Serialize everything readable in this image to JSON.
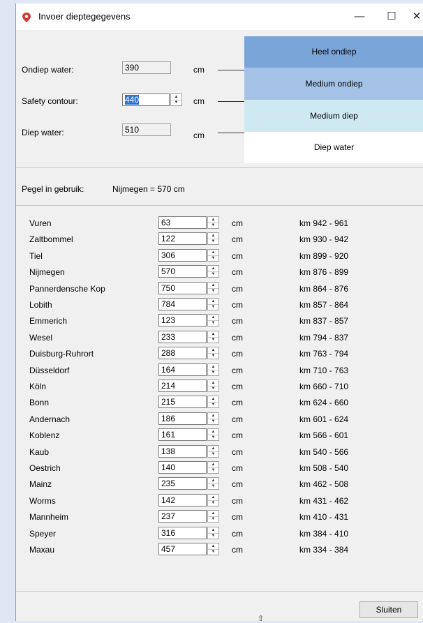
{
  "window": {
    "title": "Invoer dieptegegevens"
  },
  "depth": {
    "shallow": {
      "label": "Ondiep water:",
      "value": "390",
      "unit": "cm"
    },
    "safety": {
      "label": "Safety contour:",
      "value": "440",
      "unit": "cm"
    },
    "deep": {
      "label": "Diep water:",
      "value": "510",
      "unit": "cm"
    }
  },
  "legend": [
    {
      "label": "Heel ondiep",
      "color": "#7aa5d8"
    },
    {
      "label": "Medium ondiep",
      "color": "#a4c3e7"
    },
    {
      "label": "Medium diep",
      "color": "#cfe9f2"
    },
    {
      "label": "Diep water",
      "color": "#ffffff"
    }
  ],
  "gauge": {
    "label": "Pegel in gebruik:",
    "value": "Nijmegen = 570 cm"
  },
  "unit": "cm",
  "stations": [
    {
      "name": "Vuren",
      "value": "63",
      "range": "km 942 - 961"
    },
    {
      "name": "Zaltbommel",
      "value": "122",
      "range": "km 930 - 942"
    },
    {
      "name": "Tiel",
      "value": "306",
      "range": "km 899 - 920"
    },
    {
      "name": "Nijmegen",
      "value": "570",
      "range": "km 876 - 899"
    },
    {
      "name": "Pannerdensche Kop",
      "value": "750",
      "range": "km 864 - 876"
    },
    {
      "name": "Lobith",
      "value": "784",
      "range": "km 857 - 864"
    },
    {
      "name": "Emmerich",
      "value": "123",
      "range": "km 837 - 857"
    },
    {
      "name": "Wesel",
      "value": "233",
      "range": "km 794 - 837"
    },
    {
      "name": "Duisburg-Ruhrort",
      "value": "288",
      "range": "km 763 - 794"
    },
    {
      "name": "Düsseldorf",
      "value": "164",
      "range": "km 710 - 763"
    },
    {
      "name": "Köln",
      "value": "214",
      "range": "km 660 - 710"
    },
    {
      "name": "Bonn",
      "value": "215",
      "range": "km 624 - 660"
    },
    {
      "name": "Andernach",
      "value": "186",
      "range": "km 601 - 624"
    },
    {
      "name": "Koblenz",
      "value": "161",
      "range": "km 566 - 601"
    },
    {
      "name": "Kaub",
      "value": "138",
      "range": "km 540 - 566"
    },
    {
      "name": "Oestrich",
      "value": "140",
      "range": "km 508 - 540"
    },
    {
      "name": "Mainz",
      "value": "235",
      "range": "km 462 - 508"
    },
    {
      "name": "Worms",
      "value": "142",
      "range": "km 431 - 462"
    },
    {
      "name": "Mannheim",
      "value": "237",
      "range": "km 410 - 431"
    },
    {
      "name": "Speyer",
      "value": "316",
      "range": "km 384 - 410"
    },
    {
      "name": "Maxau",
      "value": "457",
      "range": "km 334 - 384"
    }
  ],
  "close_button": "Sluiten"
}
